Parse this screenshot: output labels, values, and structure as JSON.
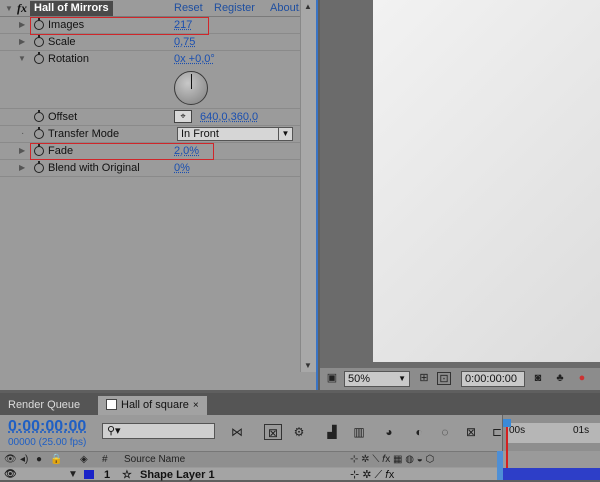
{
  "effect_controls": {
    "effect_name": "Hall of Mirrors",
    "fx_label": "fx",
    "reset_label": "Reset",
    "register_label": "Register",
    "about_label": "About...",
    "properties": {
      "images": {
        "label": "Images",
        "value": "217"
      },
      "scale": {
        "label": "Scale",
        "value": "0,75"
      },
      "rotation": {
        "label": "Rotation",
        "value": "0x +0,0°"
      },
      "offset": {
        "label": "Offset",
        "value": "640,0,360,0"
      },
      "transfer_mode": {
        "label": "Transfer Mode",
        "value": "In Front"
      },
      "fade": {
        "label": "Fade",
        "value": "2,0%"
      },
      "blend": {
        "label": "Blend with Original",
        "value": "0%"
      }
    }
  },
  "viewer": {
    "zoom": "50%",
    "timecode": "0:00:00:00"
  },
  "timeline": {
    "tabs": [
      {
        "label": "Render Queue"
      },
      {
        "label": "Hall of square",
        "close": "×"
      }
    ],
    "current_time": "0:00:00:00",
    "fps_line": "00000 (25.00 fps)",
    "search_placeholder": "",
    "ruler": {
      "start": "00s",
      "mark": "01s"
    },
    "columns": {
      "source_name": "Source Name",
      "number": "#"
    },
    "layers": [
      {
        "index": "1",
        "name": "Shape Layer 1"
      }
    ]
  }
}
